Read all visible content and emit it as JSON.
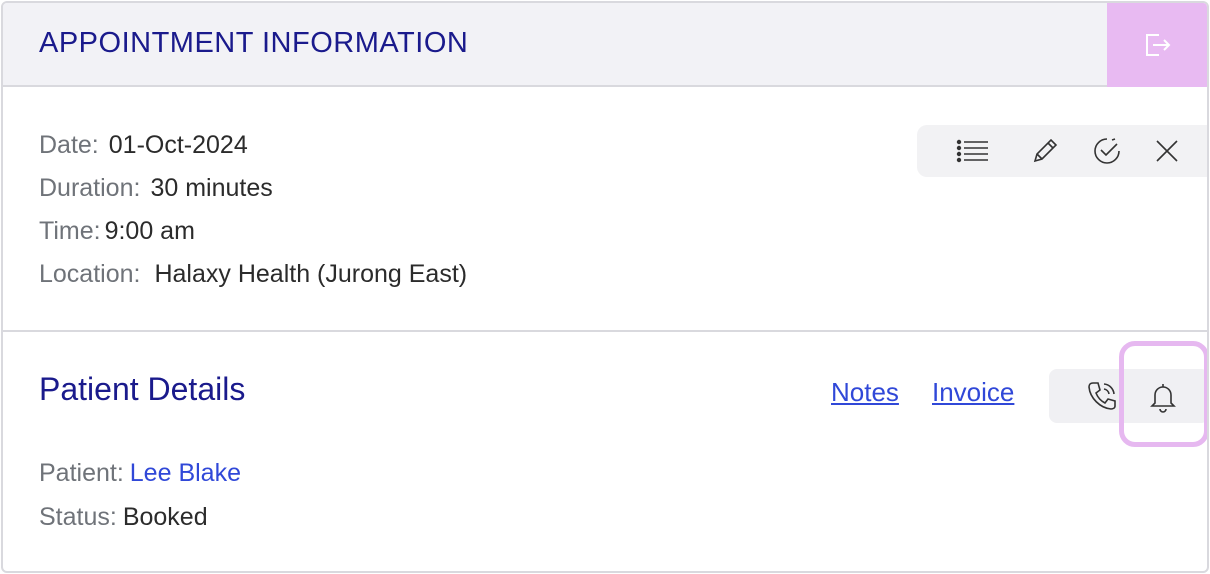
{
  "header": {
    "title": "APPOINTMENT INFORMATION",
    "exit_icon": "exit-icon"
  },
  "appointment": {
    "date_label": "Date:",
    "date_value": "01-Oct-2024",
    "duration_label": "Duration:",
    "duration_value": "30 minutes",
    "time_label": "Time:",
    "time_value": "9:00 am",
    "location_label": "Location:",
    "location_value": "Halaxy Health (Jurong East)"
  },
  "toolbar": {
    "icons": [
      "list-icon",
      "pencil-icon",
      "clock-check-icon",
      "close-icon"
    ]
  },
  "patient_details": {
    "title": "Patient Details",
    "notes_link": "Notes",
    "invoice_link": "Invoice",
    "patient_label": "Patient:",
    "patient_value": "Lee Blake",
    "status_label": "Status:",
    "status_value": "Booked",
    "contact_icons": [
      "phone-icon",
      "bell-icon"
    ]
  },
  "colors": {
    "title_navy": "#1a1a8c",
    "link_blue": "#3048d8",
    "accent_pink": "#e8baf2",
    "header_bg": "#f2f2f6"
  }
}
